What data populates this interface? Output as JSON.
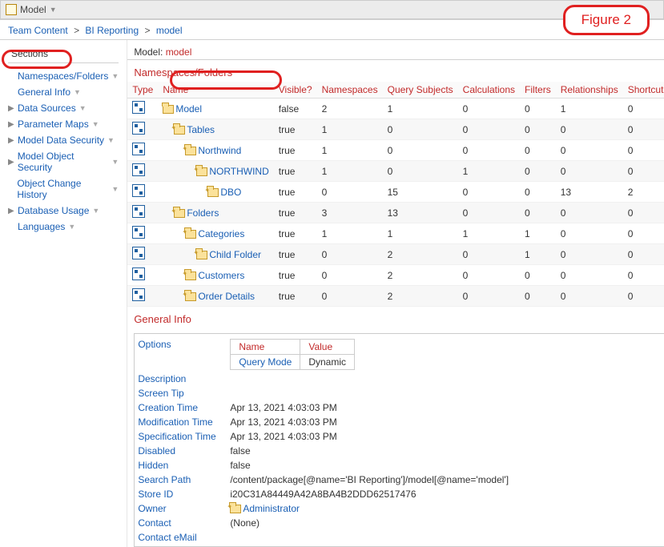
{
  "toolbar": {
    "title": "Model"
  },
  "figure_label": "Figure 2",
  "breadcrumb": [
    {
      "label": "Team Content"
    },
    {
      "label": "BI Reporting"
    },
    {
      "label": "model"
    }
  ],
  "sections_header": "Sections",
  "sidebar": {
    "items": [
      {
        "label": "Namespaces/Folders",
        "tri": false,
        "indent": true,
        "chev": true
      },
      {
        "label": "General Info",
        "tri": false,
        "indent": true,
        "chev": true
      },
      {
        "label": "Data Sources",
        "tri": true,
        "indent": false,
        "chev": true
      },
      {
        "label": "Parameter Maps",
        "tri": true,
        "indent": false,
        "chev": true
      },
      {
        "label": "Model Data Security",
        "tri": true,
        "indent": false,
        "chev": true
      },
      {
        "label": "Model Object Security",
        "tri": true,
        "indent": false,
        "chev": true
      },
      {
        "label": "Object Change History",
        "tri": false,
        "indent": true,
        "chev": true
      },
      {
        "label": "Database Usage",
        "tri": true,
        "indent": false,
        "chev": true
      },
      {
        "label": "Languages",
        "tri": false,
        "indent": true,
        "chev": true
      }
    ]
  },
  "model_label": "Model:",
  "model_value": "model",
  "ns_title": "Namespaces/Folders",
  "table": {
    "cols": [
      "Type",
      "Name",
      "Visible?",
      "Namespaces",
      "Query Subjects",
      "Calculations",
      "Filters",
      "Relationships",
      "Shortcuts"
    ],
    "rows": [
      {
        "indent": 1,
        "name": "Model",
        "visible": "false",
        "ns": "2",
        "qs": "1",
        "calc": "0",
        "fil": "0",
        "rel": "1",
        "sc": "0",
        "star": false
      },
      {
        "indent": 2,
        "name": "Tables",
        "visible": "true",
        "ns": "1",
        "qs": "0",
        "calc": "0",
        "fil": "0",
        "rel": "0",
        "sc": "0",
        "star": true
      },
      {
        "indent": 3,
        "name": "Northwind",
        "visible": "true",
        "ns": "1",
        "qs": "0",
        "calc": "0",
        "fil": "0",
        "rel": "0",
        "sc": "0",
        "star": true
      },
      {
        "indent": 4,
        "name": "NORTHWIND",
        "visible": "true",
        "ns": "1",
        "qs": "0",
        "calc": "1",
        "fil": "0",
        "rel": "0",
        "sc": "0",
        "star": true
      },
      {
        "indent": 5,
        "name": "DBO",
        "visible": "true",
        "ns": "0",
        "qs": "15",
        "calc": "0",
        "fil": "0",
        "rel": "13",
        "sc": "2",
        "star": true
      },
      {
        "indent": 2,
        "name": "Folders",
        "visible": "true",
        "ns": "3",
        "qs": "13",
        "calc": "0",
        "fil": "0",
        "rel": "0",
        "sc": "0",
        "star": true
      },
      {
        "indent": 3,
        "name": "Categories",
        "visible": "true",
        "ns": "1",
        "qs": "1",
        "calc": "1",
        "fil": "1",
        "rel": "0",
        "sc": "0",
        "star": true
      },
      {
        "indent": 4,
        "name": "Child Folder",
        "visible": "true",
        "ns": "0",
        "qs": "2",
        "calc": "0",
        "fil": "1",
        "rel": "0",
        "sc": "0",
        "star": true
      },
      {
        "indent": 3,
        "name": "Customers",
        "visible": "true",
        "ns": "0",
        "qs": "2",
        "calc": "0",
        "fil": "0",
        "rel": "0",
        "sc": "0",
        "star": true
      },
      {
        "indent": 3,
        "name": "Order Details",
        "visible": "true",
        "ns": "0",
        "qs": "2",
        "calc": "0",
        "fil": "0",
        "rel": "0",
        "sc": "0",
        "star": true
      }
    ]
  },
  "general_info": {
    "title": "General Info",
    "options_label": "Options",
    "opt_cols": {
      "name": "Name",
      "value": "Value"
    },
    "opt_row": {
      "k": "Query Mode",
      "v": "Dynamic"
    },
    "rows": [
      {
        "k": "Description",
        "v": ""
      },
      {
        "k": "Screen Tip",
        "v": ""
      },
      {
        "k": "Creation Time",
        "v": "Apr 13, 2021 4:03:03 PM"
      },
      {
        "k": "Modification Time",
        "v": "Apr 13, 2021 4:03:03 PM"
      },
      {
        "k": "Specification Time",
        "v": "Apr 13, 2021 4:03:03 PM"
      },
      {
        "k": "Disabled",
        "v": "false"
      },
      {
        "k": "Hidden",
        "v": "false"
      },
      {
        "k": "Search Path",
        "v": "/content/package[@name='BI Reporting']/model[@name='model']"
      },
      {
        "k": "Store ID",
        "v": "i20C31A84449A42A8BA4B2DDD62517476"
      },
      {
        "k": "Owner",
        "v": "Administrator",
        "icon": true
      },
      {
        "k": "Contact",
        "v": "(None)"
      },
      {
        "k": "Contact eMail",
        "v": ""
      }
    ]
  }
}
